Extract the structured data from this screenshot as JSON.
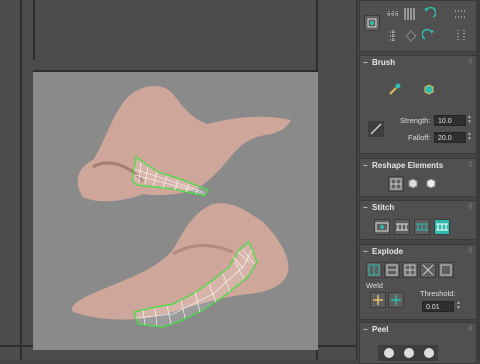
{
  "viewport": {
    "name": "uv-editor-viewport"
  },
  "panel": {
    "brush": {
      "title": "Brush",
      "strength_label": "Strength:",
      "strength_value": "10.0",
      "falloff_label": "Falloff:",
      "falloff_value": "20.0"
    },
    "reshape": {
      "title": "Reshape Elements"
    },
    "stitch": {
      "title": "Stitch"
    },
    "explode": {
      "title": "Explode",
      "weld_label": "Weld",
      "threshold_label": "Threshold:",
      "threshold_value": "0.01"
    },
    "peel": {
      "title": "Peel"
    }
  },
  "colors": {
    "accent": "#2fbcb0",
    "uv_mesh": "#3ee23e",
    "panel_bg": "#505050"
  }
}
